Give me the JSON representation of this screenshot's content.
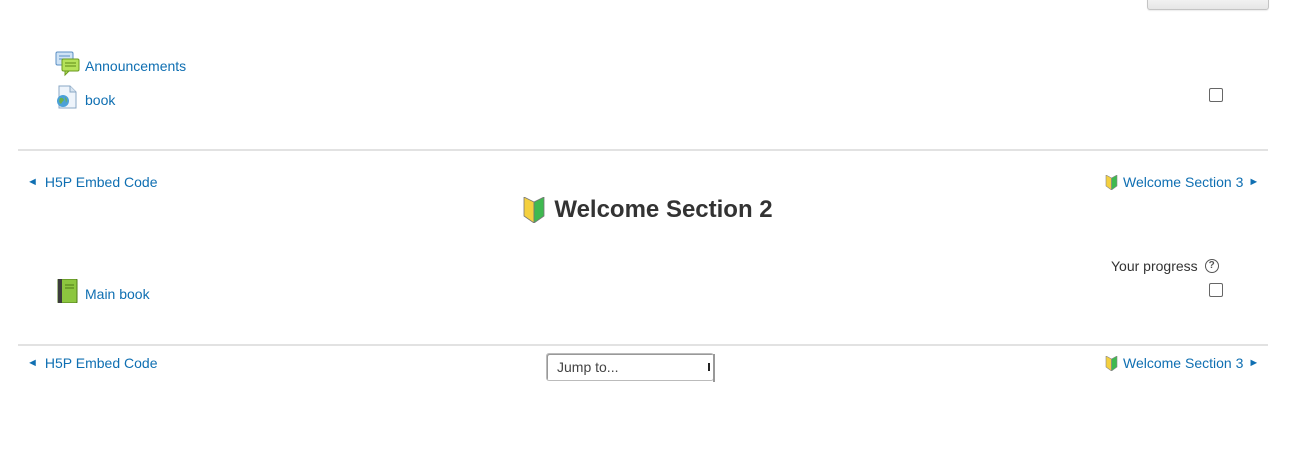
{
  "top_button": {
    "label": ""
  },
  "section1": {
    "activities": [
      {
        "label": "Announcements",
        "icon": "forum-icon"
      },
      {
        "label": "book",
        "icon": "web-page-icon"
      }
    ]
  },
  "nav_top": {
    "prev_label": "H5P Embed Code",
    "next_label": "Welcome Section 3",
    "prev_arrow": "◄",
    "next_arrow": "►"
  },
  "section2": {
    "title": "Welcome Section 2",
    "progress_label": "Your progress",
    "help_glyph": "?",
    "activities": [
      {
        "label": "Main book",
        "icon": "book-icon"
      }
    ]
  },
  "nav_bottom": {
    "prev_label": "H5P Embed Code",
    "next_label": "Welcome Section 3",
    "prev_arrow": "◄",
    "next_arrow": "►",
    "jump_label": "Jump to..."
  },
  "colors": {
    "link": "#0f6fb2",
    "text": "#333333",
    "divider": "#e2e2e2"
  }
}
